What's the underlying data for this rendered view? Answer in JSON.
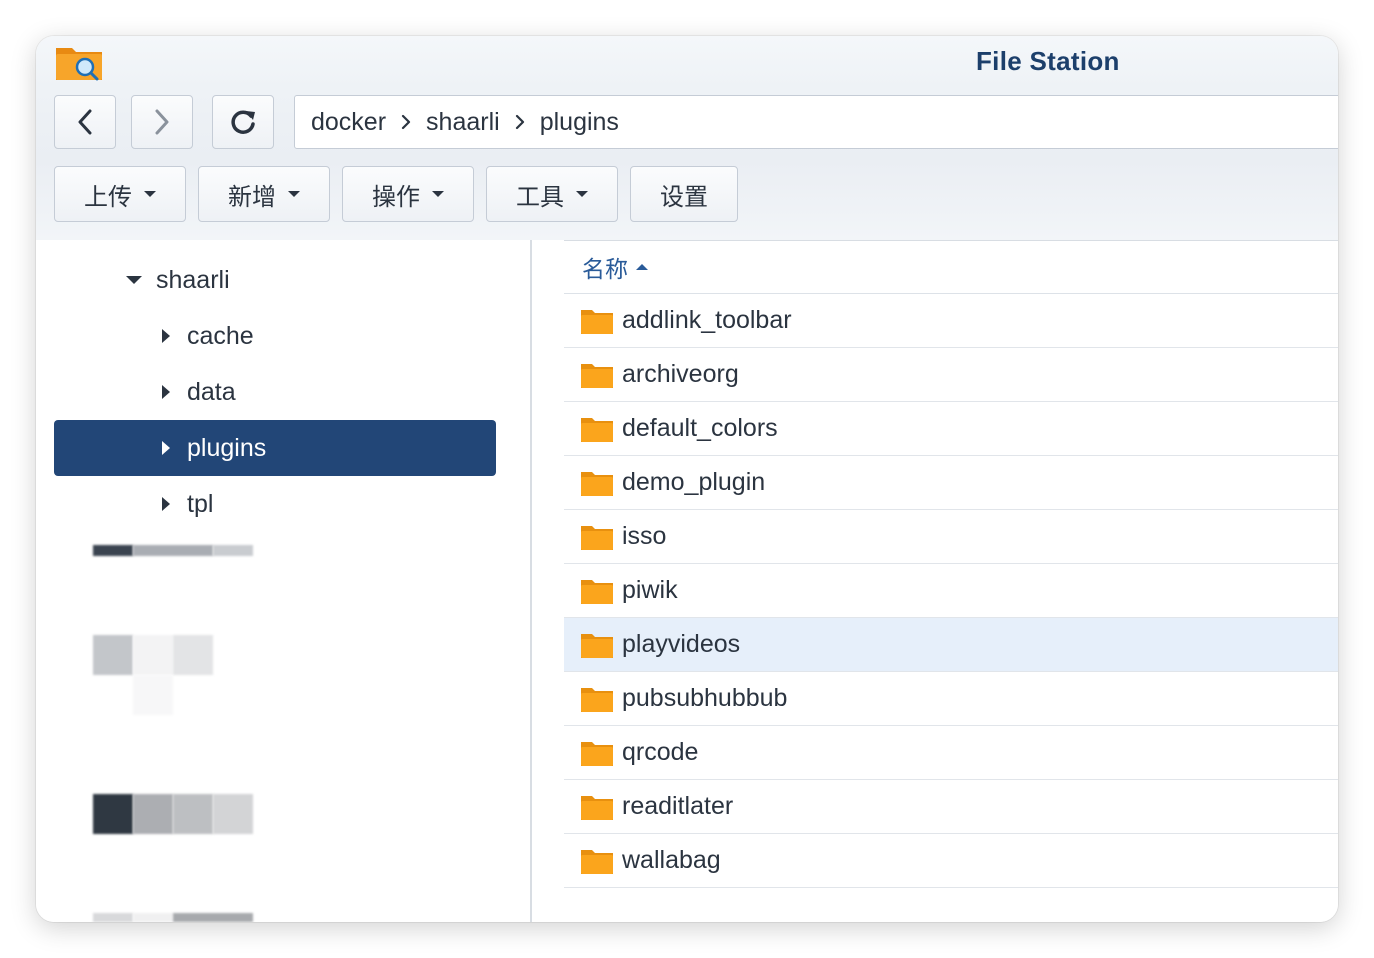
{
  "window": {
    "title": "File Station",
    "app_icon": "file-station-icon"
  },
  "nav": {
    "back_icon": "chevron-left-icon",
    "forward_icon": "chevron-right-icon",
    "refresh_icon": "refresh-icon",
    "breadcrumb": [
      "docker",
      "shaarli",
      "plugins"
    ]
  },
  "toolbar": {
    "upload_label": "上传",
    "create_label": "新增",
    "action_label": "操作",
    "tools_label": "工具",
    "settings_label": "设置"
  },
  "tree": {
    "root": {
      "label": "shaarli",
      "expanded": true
    },
    "children": [
      {
        "label": "cache",
        "selected": false
      },
      {
        "label": "data",
        "selected": false
      },
      {
        "label": "plugins",
        "selected": true
      },
      {
        "label": "tpl",
        "selected": false
      }
    ]
  },
  "file_list": {
    "column_name": "名称",
    "sort": "ascending",
    "highlighted_row": "playvideos",
    "rows": [
      "addlink_toolbar",
      "archiveorg",
      "default_colors",
      "demo_plugin",
      "isso",
      "piwik",
      "playvideos",
      "pubsubhubbub",
      "qrcode",
      "readitlater",
      "wallabag"
    ]
  },
  "colors": {
    "title": "#1c3f6b",
    "selected_tree_bg": "#224677",
    "highlight_row_bg": "#e6effa",
    "folder": "#f9a21b",
    "header_text": "#2a5b99"
  }
}
